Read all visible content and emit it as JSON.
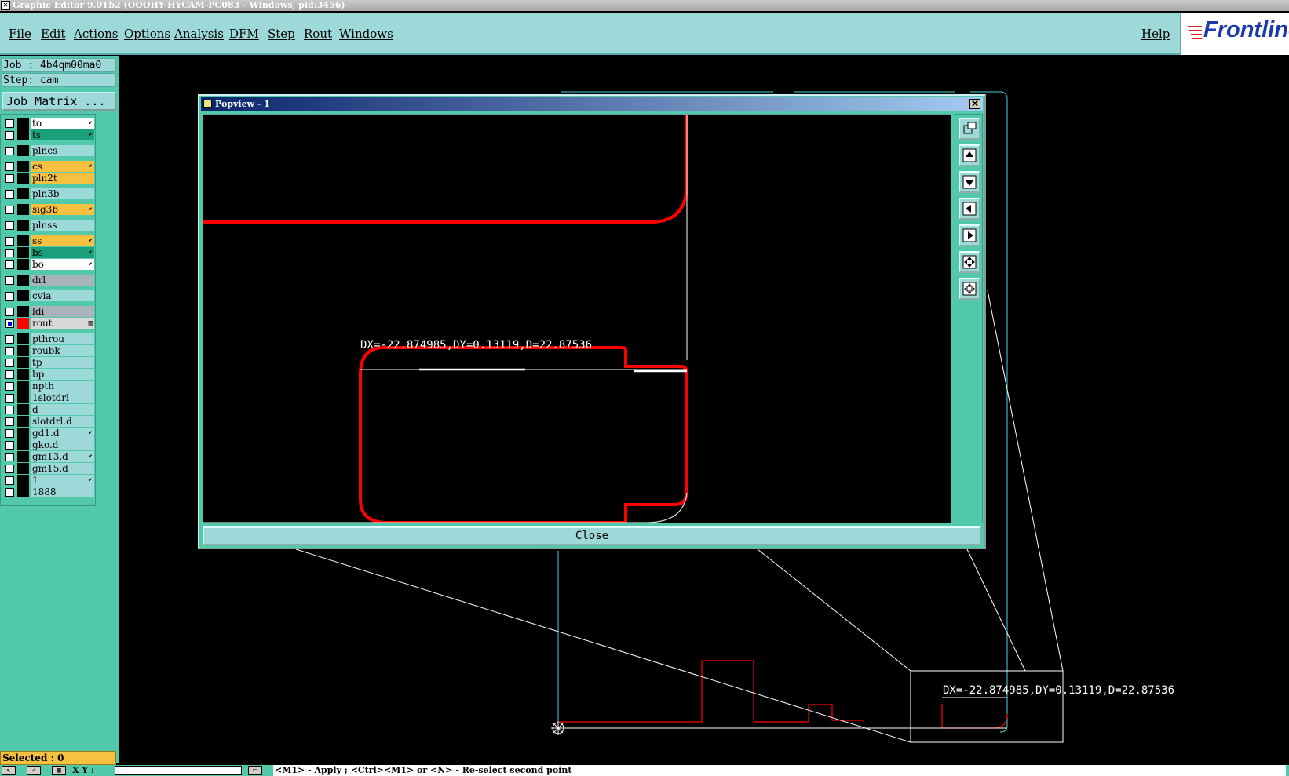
{
  "window": {
    "title": "Graphic Editor 9.0Tb2 (OOOHY-HYCAM-PC083 - Windows, pid:3456)"
  },
  "menu": {
    "items": [
      "File",
      "Edit",
      "Actions",
      "Options",
      "Analysis",
      "DFM",
      "Step",
      "Rout",
      "Windows"
    ],
    "help": "Help",
    "logo_text": "Frontline"
  },
  "job": {
    "job_label": "Job : 4b4qm00ma0",
    "step_label": "Step: cam",
    "matrix_button": "Job Matrix ..."
  },
  "layers": [
    {
      "name": "to",
      "color": "#ffffff",
      "mark": "⬋",
      "checked": false
    },
    {
      "name": "ts",
      "color": "#1aa07a",
      "mark": "⬋",
      "checked": false
    },
    {
      "name": "plncs",
      "color": "#9ed9d9",
      "mark": "",
      "checked": false
    },
    {
      "name": "cs",
      "color": "#f6c040",
      "mark": "⬋",
      "checked": false
    },
    {
      "name": "pln2t",
      "color": "#f6c040",
      "mark": "",
      "checked": false
    },
    {
      "name": "pln3b",
      "color": "#9ed9d9",
      "mark": "",
      "checked": false
    },
    {
      "name": "sig3b",
      "color": "#f6c040",
      "mark": "⬋",
      "checked": false
    },
    {
      "name": "plnss",
      "color": "#9ed9d9",
      "mark": "",
      "checked": false
    },
    {
      "name": "ss",
      "color": "#f6c040",
      "mark": "⬋",
      "checked": false
    },
    {
      "name": "bs",
      "color": "#1aa07a",
      "mark": "⬋",
      "checked": false
    },
    {
      "name": "bo",
      "color": "#ffffff",
      "mark": "⬋",
      "checked": false
    },
    {
      "name": "drl",
      "color": "#a8b4bc",
      "mark": "",
      "checked": false
    },
    {
      "name": "cvia",
      "color": "#9ed9d9",
      "mark": "",
      "checked": false
    },
    {
      "name": "ldi",
      "color": "#a8b4bc",
      "mark": "",
      "checked": false
    },
    {
      "name": "rout",
      "color": "#d8d8d8",
      "mark": "▥",
      "checked": true,
      "swatch": "#ff0000"
    },
    {
      "name": "pthrou",
      "color": "#9ed9d9",
      "mark": "",
      "checked": false
    },
    {
      "name": "roubk",
      "color": "#9ed9d9",
      "mark": "",
      "checked": false
    },
    {
      "name": "tp",
      "color": "#9ed9d9",
      "mark": "",
      "checked": false
    },
    {
      "name": "bp",
      "color": "#9ed9d9",
      "mark": "",
      "checked": false
    },
    {
      "name": "npth",
      "color": "#9ed9d9",
      "mark": "",
      "checked": false
    },
    {
      "name": "1slotdrl",
      "color": "#9ed9d9",
      "mark": "",
      "checked": false
    },
    {
      "name": "d",
      "color": "#9ed9d9",
      "mark": "",
      "checked": false
    },
    {
      "name": "slotdrl.d",
      "color": "#9ed9d9",
      "mark": "",
      "checked": false
    },
    {
      "name": "gd1.d",
      "color": "#9ed9d9",
      "mark": "⬋",
      "checked": false
    },
    {
      "name": "gko.d",
      "color": "#9ed9d9",
      "mark": "",
      "checked": false
    },
    {
      "name": "gm13.d",
      "color": "#9ed9d9",
      "mark": "⬋",
      "checked": false
    },
    {
      "name": "gm15.d",
      "color": "#9ed9d9",
      "mark": "",
      "checked": false
    },
    {
      "name": "1",
      "color": "#9ed9d9",
      "mark": "⬋",
      "checked": false
    },
    {
      "name": "1888",
      "color": "#9ed9d9",
      "mark": "",
      "checked": false
    }
  ],
  "selected": "Selected : 0",
  "status": {
    "coords_label": "X Y :",
    "message": "<M1> - Apply  ; <Ctrl><M1> or <N> - Re-select second point"
  },
  "popview": {
    "title": "Popview - 1",
    "close_label": "Close",
    "measurement": "DX=-22.874985,DY=0.13119,D=22.87536"
  },
  "canvas": {
    "measurement": "DX=-22.874985,DY=0.13119,D=22.87536"
  },
  "colors": {
    "panel": "#52c9ab",
    "panel_light": "#9ed9d9",
    "rout": "#ff0000",
    "profile": "#49d3d8"
  }
}
